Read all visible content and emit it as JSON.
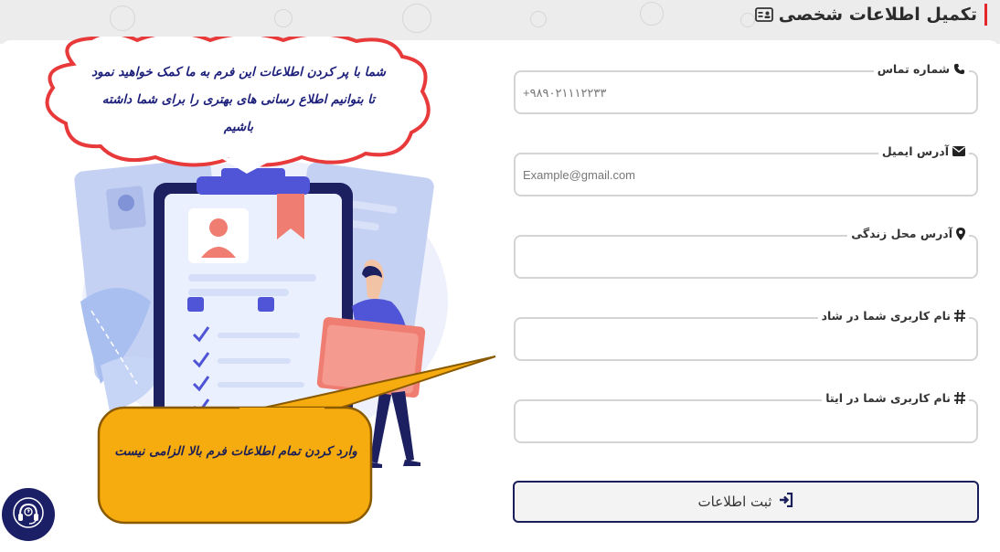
{
  "header": {
    "title": "تکمیل اطلاعات شخصی",
    "icon": "id-card-icon",
    "accent_color": "#e5262b"
  },
  "illustration": {
    "cloud_message": "شما با پر کردن اطلاعات این فرم به ما کمک خواهید نمود تا بتوانیم اطلاع رسانی های بهتری را برای شما داشته باشیم",
    "note_message": "وارد کردن تمام اطلاعات فرم بالا الزامی نیست",
    "cloud_border_color": "#e83a3a",
    "note_bg_color": "#f6ab0e"
  },
  "form": {
    "phone": {
      "label": "شماره تماس",
      "icon": "phone-icon",
      "placeholder": "+۹۸۹۰۲۱۱۱۲۲۳۳",
      "value": ""
    },
    "email": {
      "label": "آدرس ایمیل",
      "icon": "envelope-icon",
      "placeholder": "Example@gmail.com",
      "value": ""
    },
    "address": {
      "label": "آدرس محل زندگی",
      "icon": "map-marker-icon",
      "placeholder": "",
      "value": ""
    },
    "shad": {
      "label": "نام کاربری شما در شاد",
      "icon": "hashtag-icon",
      "placeholder": "",
      "value": ""
    },
    "eita": {
      "label": "نام کاربری شما در ایتا",
      "icon": "hashtag-icon",
      "placeholder": "",
      "value": ""
    },
    "submit_label": "ثبت اطلاعات",
    "submit_icon": "sign-in-icon",
    "submit_border_color": "#1a1f5c"
  },
  "support": {
    "icon": "headset-icon",
    "bg_color": "#1b1f66"
  }
}
